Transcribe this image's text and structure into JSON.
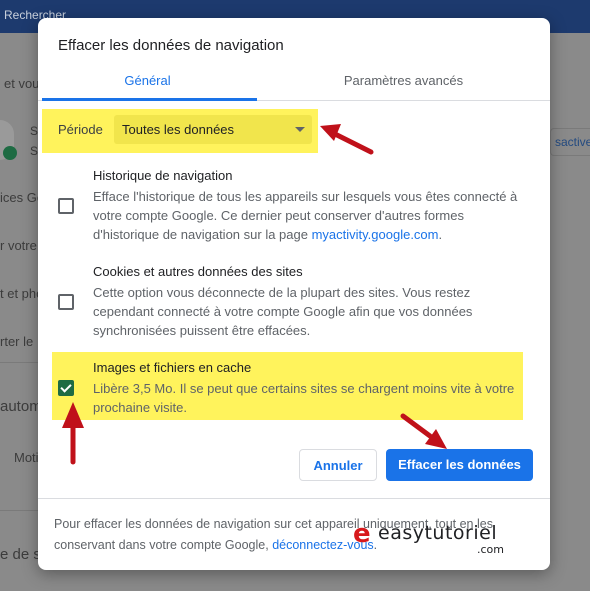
{
  "background": {
    "search_placeholder": "Rechercher",
    "fragments": [
      "et vou",
      "S",
      "S",
      "ices Go",
      "r votre",
      "t et pho",
      "rter le",
      "autom",
      "Moti",
      "e de s"
    ],
    "right_button": "sactive"
  },
  "dialog": {
    "title": "Effacer les données de navigation",
    "tabs": {
      "general": "Général",
      "advanced": "Paramètres avancés"
    },
    "period": {
      "label": "Période",
      "value": "Toutes les données"
    },
    "options": [
      {
        "title": "Historique de navigation",
        "desc": "Efface l'historique de tous les appareils sur lesquels vous êtes connecté à votre compte Google. Ce dernier peut conserver d'autres formes d'historique de navigation sur la page ",
        "link": "myactivity.google.com",
        "desc_end": ".",
        "checked": false
      },
      {
        "title": "Cookies et autres données des sites",
        "desc": "Cette option vous déconnecte de la plupart des sites. Vous restez cependant connecté à votre compte Google afin que vos données synchronisées puissent être effacées.",
        "checked": false
      },
      {
        "title": "Images et fichiers en cache",
        "desc": "Libère 3,5 Mo. Il se peut que certains sites se chargent moins vite à votre prochaine visite.",
        "checked": true
      }
    ],
    "buttons": {
      "cancel": "Annuler",
      "clear": "Effacer les données"
    },
    "footer": {
      "text": "Pour effacer les données de navigation sur cet appareil uniquement, tout en les conservant dans votre compte Google, ",
      "link": "déconnectez-vous",
      "end": "."
    }
  },
  "watermark": {
    "mark": "e",
    "text": "easytutoriel",
    "suffix": ".com"
  },
  "colors": {
    "accent": "#1a73e8",
    "highlight": "#fff35c",
    "annotation_arrow": "#c0111a",
    "checkbox_checked": "#1e6b43"
  }
}
